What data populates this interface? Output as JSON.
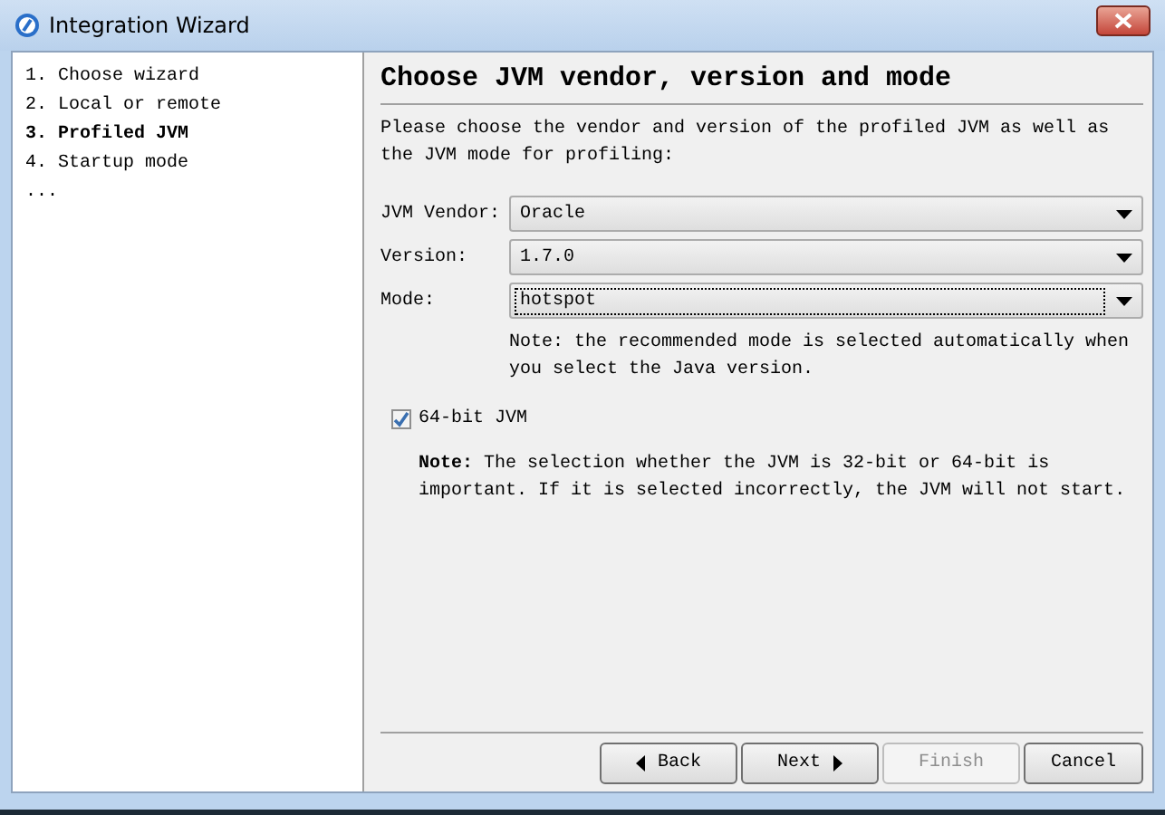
{
  "window": {
    "title": "Integration Wizard"
  },
  "steps": [
    {
      "label": "1. Choose wizard",
      "selected": false
    },
    {
      "label": "2. Local or remote",
      "selected": false
    },
    {
      "label": "3. Profiled JVM",
      "selected": true
    },
    {
      "label": "4. Startup mode",
      "selected": false
    },
    {
      "label": "...",
      "selected": false
    }
  ],
  "heading": "Choose JVM vendor, version and mode",
  "description": "Please choose the vendor and version of the profiled JVM as well as the JVM mode for profiling:",
  "fields": [
    {
      "label": "JVM Vendor:",
      "value": "Oracle",
      "focused": false
    },
    {
      "label": "Version:",
      "value": "1.7.0",
      "focused": false
    },
    {
      "label": "Mode:",
      "value": "hotspot",
      "focused": true
    }
  ],
  "mode_note": "Note: the recommended mode is selected automatically when you select the Java version.",
  "checkbox": {
    "label": "64-bit JVM",
    "checked": true
  },
  "bit_note": "**Note:** The selection whether the JVM is 32-bit or 64-bit is important. If it is selected incorrectly, the JVM will not start.",
  "buttons": [
    {
      "label": "Back",
      "kind": "back",
      "disabled": false
    },
    {
      "label": "Next",
      "kind": "next",
      "disabled": false
    },
    {
      "label": "Finish",
      "kind": "plain",
      "disabled": true
    },
    {
      "label": "Cancel",
      "kind": "plain",
      "disabled": false
    }
  ]
}
